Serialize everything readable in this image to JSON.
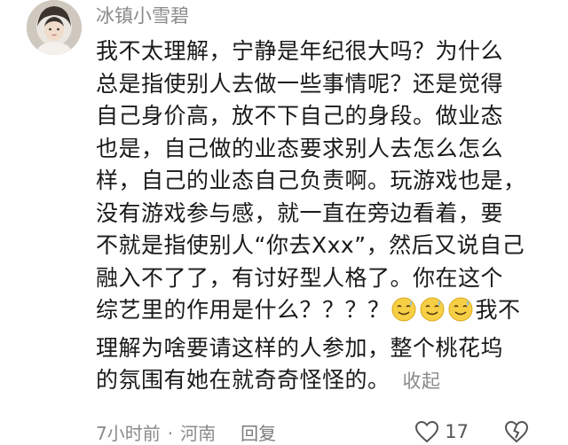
{
  "comment": {
    "username": "冰镇小雪碧",
    "avatar_icon": "user-avatar-icon",
    "lines": [
      "我不太理解，宁静是年纪很大吗？为什么",
      "总是指使别人去做一些事情呢？还是觉得",
      "自己身价高，放不下自己的身段。做业态",
      "也是，自己做的业态要求别人去怎么怎么",
      "样，自己的业态自己负责啊。玩游戏也是，",
      "没有游戏参与感，就一直在旁边看着，要",
      "不就是指使别人“你去Xxx”，然后又说自己",
      "融入不了了，有讨好型人格了。你在这个",
      "综艺里的作用是什么？？？？"
    ],
    "line_after_emoji": "我不",
    "emoji_icon": "sweat-smile-emoji-icon",
    "emoji_count": 3,
    "lines_tail": [
      "理解为啥要请这样的人参加，整个桃花坞"
    ],
    "last_line": "的氛围有她在就奇奇怪怪的。",
    "collapse_label": "收起",
    "time": "7小时前",
    "location": "河南",
    "reply_label": "回复",
    "like_count": "17",
    "like_icon": "heart-icon",
    "dislike_icon": "broken-heart-icon",
    "colors": {
      "text": "#1a1a1a",
      "meta": "#8a8a8a",
      "background": "#ffffff"
    }
  }
}
